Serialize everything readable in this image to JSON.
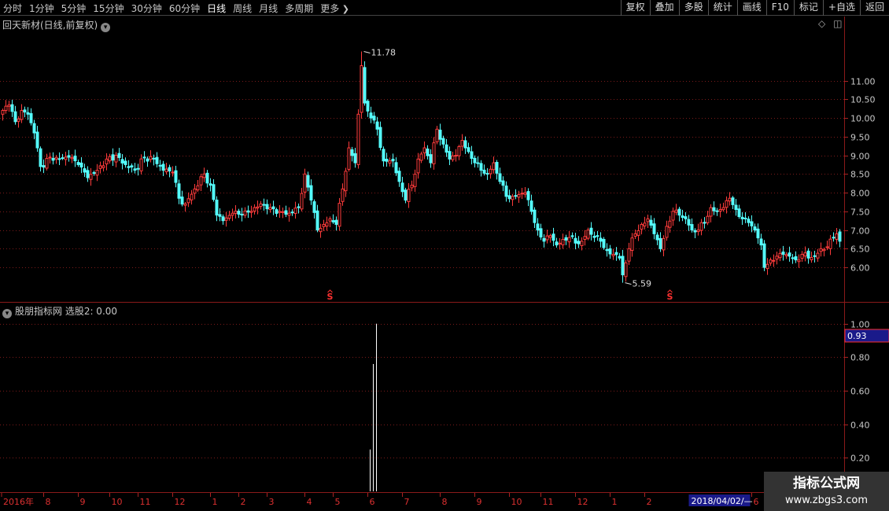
{
  "toolbar": {
    "periods": [
      "分时",
      "1分钟",
      "5分钟",
      "15分钟",
      "30分钟",
      "60分钟",
      "日线",
      "周线",
      "月线",
      "多周期"
    ],
    "active_period": "日线",
    "more_label": "更多",
    "tools": [
      "复权",
      "叠加",
      "多股",
      "统计",
      "画线",
      "F10",
      "标记",
      "+自选",
      "返回"
    ]
  },
  "main_panel": {
    "title": "回天新材(日线,前复权)"
  },
  "indicator_panel": {
    "title": "股朋指标网 选股2: 0.00",
    "current_value_label": "0.93"
  },
  "colors": {
    "up": "#ff3b3b",
    "down": "#54fcfc",
    "grid": "#7a1a1a",
    "axis_text": "#c8c8c8",
    "highlight_box": "#1a1a8a",
    "signal": "#ff3030"
  },
  "chart_data": [
    {
      "type": "candlestick",
      "title": "回天新材(日线,前复权)",
      "y_ticks": [
        6.0,
        6.5,
        7.0,
        7.5,
        8.0,
        8.5,
        9.0,
        9.5,
        10.0,
        10.5,
        11.0
      ],
      "ylim": [
        5.35,
        12.4
      ],
      "annotations": [
        {
          "label": "11.78",
          "value": 11.78,
          "period_index": 114
        },
        {
          "label": "5.59",
          "value": 5.59,
          "period_index": 197
        }
      ],
      "signal_marks": [
        {
          "label": "S",
          "period_index": 104
        },
        {
          "label": "S",
          "period_index": 212
        }
      ],
      "anchors": [
        [
          0,
          10.2
        ],
        [
          2,
          10.35
        ],
        [
          4,
          9.9
        ],
        [
          6,
          10.2
        ],
        [
          8,
          10.1
        ],
        [
          10,
          9.6
        ],
        [
          12,
          8.7
        ],
        [
          15,
          8.95
        ],
        [
          18,
          8.9
        ],
        [
          21,
          8.95
        ],
        [
          24,
          8.75
        ],
        [
          27,
          8.4
        ],
        [
          30,
          8.6
        ],
        [
          33,
          8.9
        ],
        [
          36,
          9.0
        ],
        [
          39,
          8.75
        ],
        [
          42,
          8.6
        ],
        [
          45,
          8.95
        ],
        [
          48,
          8.9
        ],
        [
          51,
          8.6
        ],
        [
          54,
          8.55
        ],
        [
          56,
          7.85
        ],
        [
          58,
          7.7
        ],
        [
          61,
          8.1
        ],
        [
          64,
          8.5
        ],
        [
          66,
          8.2
        ],
        [
          68,
          7.4
        ],
        [
          70,
          7.25
        ],
        [
          73,
          7.45
        ],
        [
          76,
          7.4
        ],
        [
          79,
          7.5
        ],
        [
          82,
          7.7
        ],
        [
          85,
          7.6
        ],
        [
          88,
          7.5
        ],
        [
          91,
          7.45
        ],
        [
          94,
          7.6
        ],
        [
          96,
          8.5
        ],
        [
          98,
          7.8
        ],
        [
          100,
          7.0
        ],
        [
          102,
          7.15
        ],
        [
          104,
          7.3
        ],
        [
          106,
          7.15
        ],
        [
          108,
          8.1
        ],
        [
          110,
          9.2
        ],
        [
          112,
          8.8
        ],
        [
          113,
          10.1
        ],
        [
          114,
          11.4
        ],
        [
          115,
          10.4
        ],
        [
          117,
          10.0
        ],
        [
          119,
          9.7
        ],
        [
          121,
          8.85
        ],
        [
          124,
          8.85
        ],
        [
          126,
          8.3
        ],
        [
          128,
          7.8
        ],
        [
          130,
          8.2
        ],
        [
          132,
          8.9
        ],
        [
          134,
          9.2
        ],
        [
          136,
          8.8
        ],
        [
          138,
          9.7
        ],
        [
          140,
          9.3
        ],
        [
          142,
          8.9
        ],
        [
          144,
          9.0
        ],
        [
          146,
          9.4
        ],
        [
          148,
          9.1
        ],
        [
          150,
          8.8
        ],
        [
          152,
          8.6
        ],
        [
          154,
          8.5
        ],
        [
          156,
          8.8
        ],
        [
          158,
          8.3
        ],
        [
          160,
          7.9
        ],
        [
          162,
          7.9
        ],
        [
          164,
          7.95
        ],
        [
          166,
          8.0
        ],
        [
          168,
          7.5
        ],
        [
          170,
          7.0
        ],
        [
          172,
          6.7
        ],
        [
          174,
          6.85
        ],
        [
          176,
          6.6
        ],
        [
          178,
          6.75
        ],
        [
          180,
          6.8
        ],
        [
          182,
          6.65
        ],
        [
          184,
          6.7
        ],
        [
          186,
          7.0
        ],
        [
          188,
          6.8
        ],
        [
          190,
          6.7
        ],
        [
          192,
          6.45
        ],
        [
          194,
          6.35
        ],
        [
          196,
          6.25
        ],
        [
          197,
          5.8
        ],
        [
          199,
          6.5
        ],
        [
          201,
          6.9
        ],
        [
          203,
          7.15
        ],
        [
          205,
          7.3
        ],
        [
          207,
          6.9
        ],
        [
          209,
          6.5
        ],
        [
          211,
          7.1
        ],
        [
          213,
          7.5
        ],
        [
          215,
          7.4
        ],
        [
          217,
          7.3
        ],
        [
          219,
          7.0
        ],
        [
          221,
          7.0
        ],
        [
          223,
          7.2
        ],
        [
          225,
          7.6
        ],
        [
          227,
          7.5
        ],
        [
          229,
          7.6
        ],
        [
          231,
          7.85
        ],
        [
          233,
          7.55
        ],
        [
          235,
          7.3
        ],
        [
          237,
          7.2
        ],
        [
          239,
          7.0
        ],
        [
          241,
          6.6
        ],
        [
          242,
          6.0
        ],
        [
          244,
          6.2
        ],
        [
          246,
          6.3
        ],
        [
          248,
          6.35
        ],
        [
          250,
          6.3
        ],
        [
          252,
          6.2
        ],
        [
          254,
          6.35
        ],
        [
          256,
          6.25
        ],
        [
          258,
          6.3
        ],
        [
          260,
          6.5
        ],
        [
          262,
          6.55
        ],
        [
          264,
          6.8
        ],
        [
          265,
          6.9
        ],
        [
          266,
          6.7
        ]
      ]
    },
    {
      "type": "bar",
      "title": "股朋指标网 选股2: 0.00",
      "y_ticks": [
        0.2,
        0.4,
        0.6,
        0.8,
        1.0
      ],
      "ylim": [
        0.0,
        1.06
      ],
      "points": [
        {
          "period_index": 117,
          "value": 0.25
        },
        {
          "period_index": 118,
          "value": 0.76
        },
        {
          "period_index": 119,
          "value": 1.0
        }
      ]
    }
  ],
  "time_axis": {
    "labels": [
      {
        "text": "2016年",
        "period_index": 0
      },
      {
        "text": "8",
        "period_index": 13
      },
      {
        "text": "9",
        "period_index": 24
      },
      {
        "text": "10",
        "period_index": 34
      },
      {
        "text": "11",
        "period_index": 43
      },
      {
        "text": "12",
        "period_index": 54
      },
      {
        "text": "1",
        "period_index": 66
      },
      {
        "text": "2",
        "period_index": 75
      },
      {
        "text": "3",
        "period_index": 84
      },
      {
        "text": "4",
        "period_index": 96
      },
      {
        "text": "5",
        "period_index": 105
      },
      {
        "text": "6",
        "period_index": 116
      },
      {
        "text": "7",
        "period_index": 127
      },
      {
        "text": "8",
        "period_index": 139
      },
      {
        "text": "9",
        "period_index": 150
      },
      {
        "text": "10",
        "period_index": 161
      },
      {
        "text": "11",
        "period_index": 171
      },
      {
        "text": "12",
        "period_index": 182
      },
      {
        "text": "1",
        "period_index": 193
      },
      {
        "text": "2",
        "period_index": 204
      },
      {
        "text": "6",
        "period_index": 238
      }
    ],
    "cursor_label": "2018/04/02/—",
    "cursor_period_index": 218
  },
  "watermark": {
    "line1": "指标公式网",
    "line2": "www.zbgs3.com"
  }
}
